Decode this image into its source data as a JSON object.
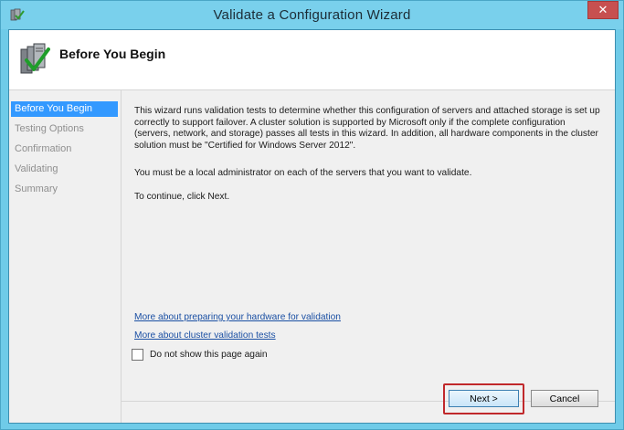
{
  "window": {
    "title": "Validate a Configuration Wizard",
    "close_label": "✕"
  },
  "header": {
    "title": "Before You Begin"
  },
  "nav": {
    "items": [
      {
        "label": "Before You Begin",
        "active": true
      },
      {
        "label": "Testing Options",
        "active": false
      },
      {
        "label": "Confirmation",
        "active": false
      },
      {
        "label": "Validating",
        "active": false
      },
      {
        "label": "Summary",
        "active": false
      }
    ]
  },
  "content": {
    "description": "This wizard runs validation tests to determine whether this configuration of servers and attached storage is set up correctly to support failover. A cluster solution is supported by Microsoft only if the complete configuration (servers, network, and storage) passes all tests in this wizard. In addition, all hardware components in the cluster solution must be \"Certified for Windows Server 2012\".",
    "admin_note": "You must be a local administrator on each of the servers that you want to validate.",
    "continue_note": "To continue, click Next.",
    "links": [
      "More about preparing your hardware for validation",
      "More about cluster validation tests"
    ],
    "checkbox_label": "Do not show this page again",
    "checkbox_checked": false
  },
  "buttons": {
    "next": "Next >",
    "cancel": "Cancel"
  },
  "colors": {
    "titlebar": "#79d0ec",
    "nav_active": "#3399ff",
    "close": "#c75050",
    "highlight": "#c0282b",
    "link": "#1a4fa3"
  }
}
